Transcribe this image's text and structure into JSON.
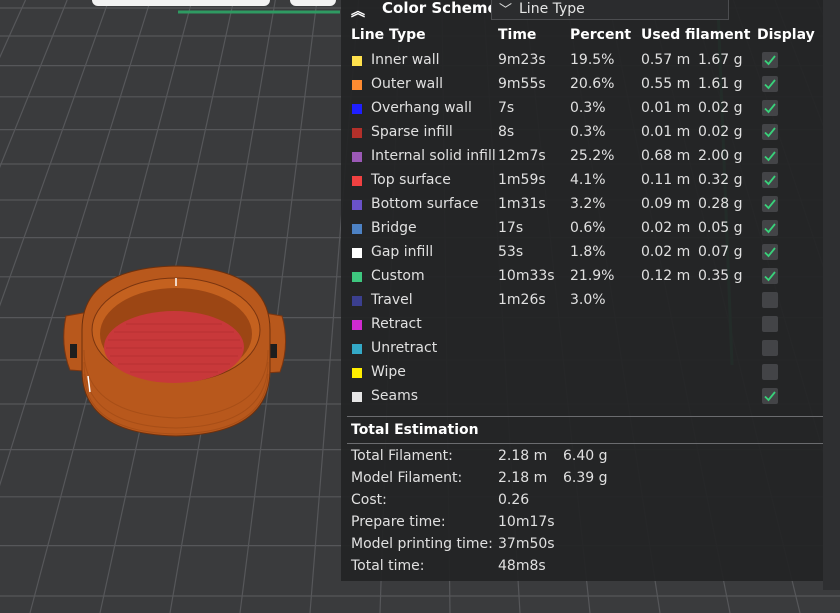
{
  "header": {
    "title": "Color Scheme",
    "scheme_value": "Line Type"
  },
  "columns": {
    "line_type": "Line Type",
    "time": "Time",
    "percent": "Percent",
    "used_filament": "Used filament",
    "display": "Display"
  },
  "rows": [
    {
      "name": "Inner wall",
      "color": "#ffe14d",
      "time": "9m23s",
      "percent": "19.5%",
      "length": "0.57 m",
      "weight": "1.67 g",
      "display": true
    },
    {
      "name": "Outer wall",
      "color": "#ff8b31",
      "time": "9m55s",
      "percent": "20.6%",
      "length": "0.55 m",
      "weight": "1.61 g",
      "display": true
    },
    {
      "name": "Overhang wall",
      "color": "#1f1fff",
      "time": "7s",
      "percent": "0.3%",
      "length": "0.01 m",
      "weight": "0.02 g",
      "display": true
    },
    {
      "name": "Sparse infill",
      "color": "#b3302a",
      "time": "8s",
      "percent": "0.3%",
      "length": "0.01 m",
      "weight": "0.02 g",
      "display": true
    },
    {
      "name": "Internal solid infill",
      "color": "#9b59b6",
      "time": "12m7s",
      "percent": "25.2%",
      "length": "0.68 m",
      "weight": "2.00 g",
      "display": true
    },
    {
      "name": "Top surface",
      "color": "#f04141",
      "time": "1m59s",
      "percent": "4.1%",
      "length": "0.11 m",
      "weight": "0.32 g",
      "display": true
    },
    {
      "name": "Bottom surface",
      "color": "#6a52c9",
      "time": "1m31s",
      "percent": "3.2%",
      "length": "0.09 m",
      "weight": "0.28 g",
      "display": true
    },
    {
      "name": "Bridge",
      "color": "#4d82c4",
      "time": "17s",
      "percent": "0.6%",
      "length": "0.02 m",
      "weight": "0.05 g",
      "display": true
    },
    {
      "name": "Gap infill",
      "color": "#ffffff",
      "time": "53s",
      "percent": "1.8%",
      "length": "0.02 m",
      "weight": "0.07 g",
      "display": true
    },
    {
      "name": "Custom",
      "color": "#3ec77f",
      "time": "10m33s",
      "percent": "21.9%",
      "length": "0.12 m",
      "weight": "0.35 g",
      "display": true
    },
    {
      "name": "Travel",
      "color": "#3b3f8f",
      "time": "1m26s",
      "percent": "3.0%",
      "length": "",
      "weight": "",
      "display": false
    },
    {
      "name": "Retract",
      "color": "#d12ad1",
      "time": "",
      "percent": "",
      "length": "",
      "weight": "",
      "display": false
    },
    {
      "name": "Unretract",
      "color": "#34a9c7",
      "time": "",
      "percent": "",
      "length": "",
      "weight": "",
      "display": false
    },
    {
      "name": "Wipe",
      "color": "#ffee00",
      "time": "",
      "percent": "",
      "length": "",
      "weight": "",
      "display": false
    },
    {
      "name": "Seams",
      "color": "#e6e6e6",
      "time": "",
      "percent": "",
      "length": "",
      "weight": "",
      "display": true
    }
  ],
  "totals": {
    "title": "Total Estimation",
    "items": [
      {
        "label": "Total Filament:",
        "v1": "2.18 m",
        "v2": "6.40 g"
      },
      {
        "label": "Model Filament:",
        "v1": "2.18 m",
        "v2": "6.39 g"
      },
      {
        "label": "Cost:",
        "v1": "0.26",
        "v2": ""
      },
      {
        "label": "Prepare time:",
        "v1": "10m17s",
        "v2": ""
      },
      {
        "label": "Model printing time:",
        "v1": "37m50s",
        "v2": ""
      },
      {
        "label": "Total time:",
        "v1": "48m8s",
        "v2": ""
      }
    ]
  },
  "colors": {
    "checkmark": "#39d17a",
    "model_orange": "#b8581c",
    "model_infill": "#c8383a",
    "plate_grid": "#56575a",
    "plate_bg": "#3a3b3d"
  }
}
